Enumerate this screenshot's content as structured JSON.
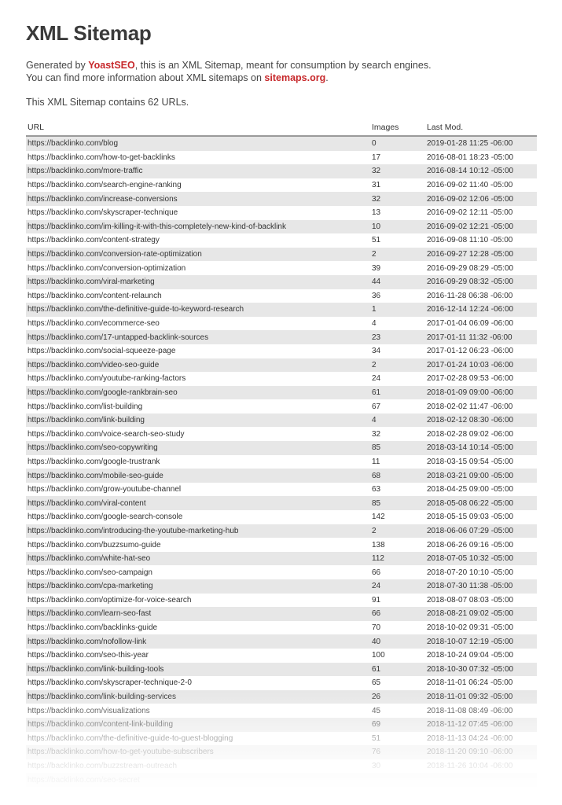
{
  "page": {
    "title": "XML Sitemap",
    "intro_prefix": "Generated by ",
    "intro_link1": "YoastSEO",
    "intro_middle": ", this is an XML Sitemap, meant for consumption by search engines.",
    "intro_line2_prefix": "You can find more information about XML sitemaps on ",
    "intro_link2": "sitemaps.org",
    "intro_line2_suffix": ".",
    "count_text": "This XML Sitemap contains 62 URLs.",
    "link_color": "#c7282b"
  },
  "table": {
    "headers": {
      "url": "URL",
      "images": "Images",
      "lastmod": "Last Mod."
    },
    "rows": [
      {
        "url": "https://backlinko.com/blog",
        "images": "0",
        "lastmod": "2019-01-28 11:25 -06:00"
      },
      {
        "url": "https://backlinko.com/how-to-get-backlinks",
        "images": "17",
        "lastmod": "2016-08-01 18:23 -05:00"
      },
      {
        "url": "https://backlinko.com/more-traffic",
        "images": "32",
        "lastmod": "2016-08-14 10:12 -05:00"
      },
      {
        "url": "https://backlinko.com/search-engine-ranking",
        "images": "31",
        "lastmod": "2016-09-02 11:40 -05:00"
      },
      {
        "url": "https://backlinko.com/increase-conversions",
        "images": "32",
        "lastmod": "2016-09-02 12:06 -05:00"
      },
      {
        "url": "https://backlinko.com/skyscraper-technique",
        "images": "13",
        "lastmod": "2016-09-02 12:11 -05:00"
      },
      {
        "url": "https://backlinko.com/im-killing-it-with-this-completely-new-kind-of-backlink",
        "images": "10",
        "lastmod": "2016-09-02 12:21 -05:00"
      },
      {
        "url": "https://backlinko.com/content-strategy",
        "images": "51",
        "lastmod": "2016-09-08 11:10 -05:00"
      },
      {
        "url": "https://backlinko.com/conversion-rate-optimization",
        "images": "2",
        "lastmod": "2016-09-27 12:28 -05:00"
      },
      {
        "url": "https://backlinko.com/conversion-optimization",
        "images": "39",
        "lastmod": "2016-09-29 08:29 -05:00"
      },
      {
        "url": "https://backlinko.com/viral-marketing",
        "images": "44",
        "lastmod": "2016-09-29 08:32 -05:00"
      },
      {
        "url": "https://backlinko.com/content-relaunch",
        "images": "36",
        "lastmod": "2016-11-28 06:38 -06:00"
      },
      {
        "url": "https://backlinko.com/the-definitive-guide-to-keyword-research",
        "images": "1",
        "lastmod": "2016-12-14 12:24 -06:00"
      },
      {
        "url": "https://backlinko.com/ecommerce-seo",
        "images": "4",
        "lastmod": "2017-01-04 06:09 -06:00"
      },
      {
        "url": "https://backlinko.com/17-untapped-backlink-sources",
        "images": "23",
        "lastmod": "2017-01-11 11:32 -06:00"
      },
      {
        "url": "https://backlinko.com/social-squeeze-page",
        "images": "34",
        "lastmod": "2017-01-12 06:23 -06:00"
      },
      {
        "url": "https://backlinko.com/video-seo-guide",
        "images": "2",
        "lastmod": "2017-01-24 10:03 -06:00"
      },
      {
        "url": "https://backlinko.com/youtube-ranking-factors",
        "images": "24",
        "lastmod": "2017-02-28 09:53 -06:00"
      },
      {
        "url": "https://backlinko.com/google-rankbrain-seo",
        "images": "61",
        "lastmod": "2018-01-09 09:00 -06:00"
      },
      {
        "url": "https://backlinko.com/list-building",
        "images": "67",
        "lastmod": "2018-02-02 11:47 -06:00"
      },
      {
        "url": "https://backlinko.com/link-building",
        "images": "4",
        "lastmod": "2018-02-12 08:30 -06:00"
      },
      {
        "url": "https://backlinko.com/voice-search-seo-study",
        "images": "32",
        "lastmod": "2018-02-28 09:02 -06:00"
      },
      {
        "url": "https://backlinko.com/seo-copywriting",
        "images": "85",
        "lastmod": "2018-03-14 10:14 -05:00"
      },
      {
        "url": "https://backlinko.com/google-trustrank",
        "images": "11",
        "lastmod": "2018-03-15 09:54 -05:00"
      },
      {
        "url": "https://backlinko.com/mobile-seo-guide",
        "images": "68",
        "lastmod": "2018-03-21 09:00 -05:00"
      },
      {
        "url": "https://backlinko.com/grow-youtube-channel",
        "images": "63",
        "lastmod": "2018-04-25 09:00 -05:00"
      },
      {
        "url": "https://backlinko.com/viral-content",
        "images": "85",
        "lastmod": "2018-05-08 06:22 -05:00"
      },
      {
        "url": "https://backlinko.com/google-search-console",
        "images": "142",
        "lastmod": "2018-05-15 09:03 -05:00"
      },
      {
        "url": "https://backlinko.com/introducing-the-youtube-marketing-hub",
        "images": "2",
        "lastmod": "2018-06-06 07:29 -05:00"
      },
      {
        "url": "https://backlinko.com/buzzsumo-guide",
        "images": "138",
        "lastmod": "2018-06-26 09:16 -05:00"
      },
      {
        "url": "https://backlinko.com/white-hat-seo",
        "images": "112",
        "lastmod": "2018-07-05 10:32 -05:00"
      },
      {
        "url": "https://backlinko.com/seo-campaign",
        "images": "66",
        "lastmod": "2018-07-20 10:10 -05:00"
      },
      {
        "url": "https://backlinko.com/cpa-marketing",
        "images": "24",
        "lastmod": "2018-07-30 11:38 -05:00"
      },
      {
        "url": "https://backlinko.com/optimize-for-voice-search",
        "images": "91",
        "lastmod": "2018-08-07 08:03 -05:00"
      },
      {
        "url": "https://backlinko.com/learn-seo-fast",
        "images": "66",
        "lastmod": "2018-08-21 09:02 -05:00"
      },
      {
        "url": "https://backlinko.com/backlinks-guide",
        "images": "70",
        "lastmod": "2018-10-02 09:31 -05:00"
      },
      {
        "url": "https://backlinko.com/nofollow-link",
        "images": "40",
        "lastmod": "2018-10-07 12:19 -05:00"
      },
      {
        "url": "https://backlinko.com/seo-this-year",
        "images": "100",
        "lastmod": "2018-10-24 09:04 -05:00"
      },
      {
        "url": "https://backlinko.com/link-building-tools",
        "images": "61",
        "lastmod": "2018-10-30 07:32 -05:00"
      },
      {
        "url": "https://backlinko.com/skyscraper-technique-2-0",
        "images": "65",
        "lastmod": "2018-11-01 06:24 -05:00"
      },
      {
        "url": "https://backlinko.com/link-building-services",
        "images": "26",
        "lastmod": "2018-11-01 09:32 -05:00"
      },
      {
        "url": "https://backlinko.com/visualizations",
        "images": "45",
        "lastmod": "2018-11-08 08:49 -06:00"
      },
      {
        "url": "https://backlinko.com/content-link-building",
        "images": "69",
        "lastmod": "2018-11-12 07:45 -06:00"
      },
      {
        "url": "https://backlinko.com/the-definitive-guide-to-guest-blogging",
        "images": "51",
        "lastmod": "2018-11-13 04:24 -06:00"
      },
      {
        "url": "https://backlinko.com/how-to-get-youtube-subscribers",
        "images": "76",
        "lastmod": "2018-11-20 09:10 -06:00"
      },
      {
        "url": "https://backlinko.com/buzzstream-outreach",
        "images": "30",
        "lastmod": "2018-11-26 10:04 -06:00"
      },
      {
        "url": "https://backlinko.com/seo-secret",
        "images": "",
        "lastmod": ""
      },
      {
        "url": "",
        "images": "",
        "lastmod": ""
      }
    ]
  }
}
